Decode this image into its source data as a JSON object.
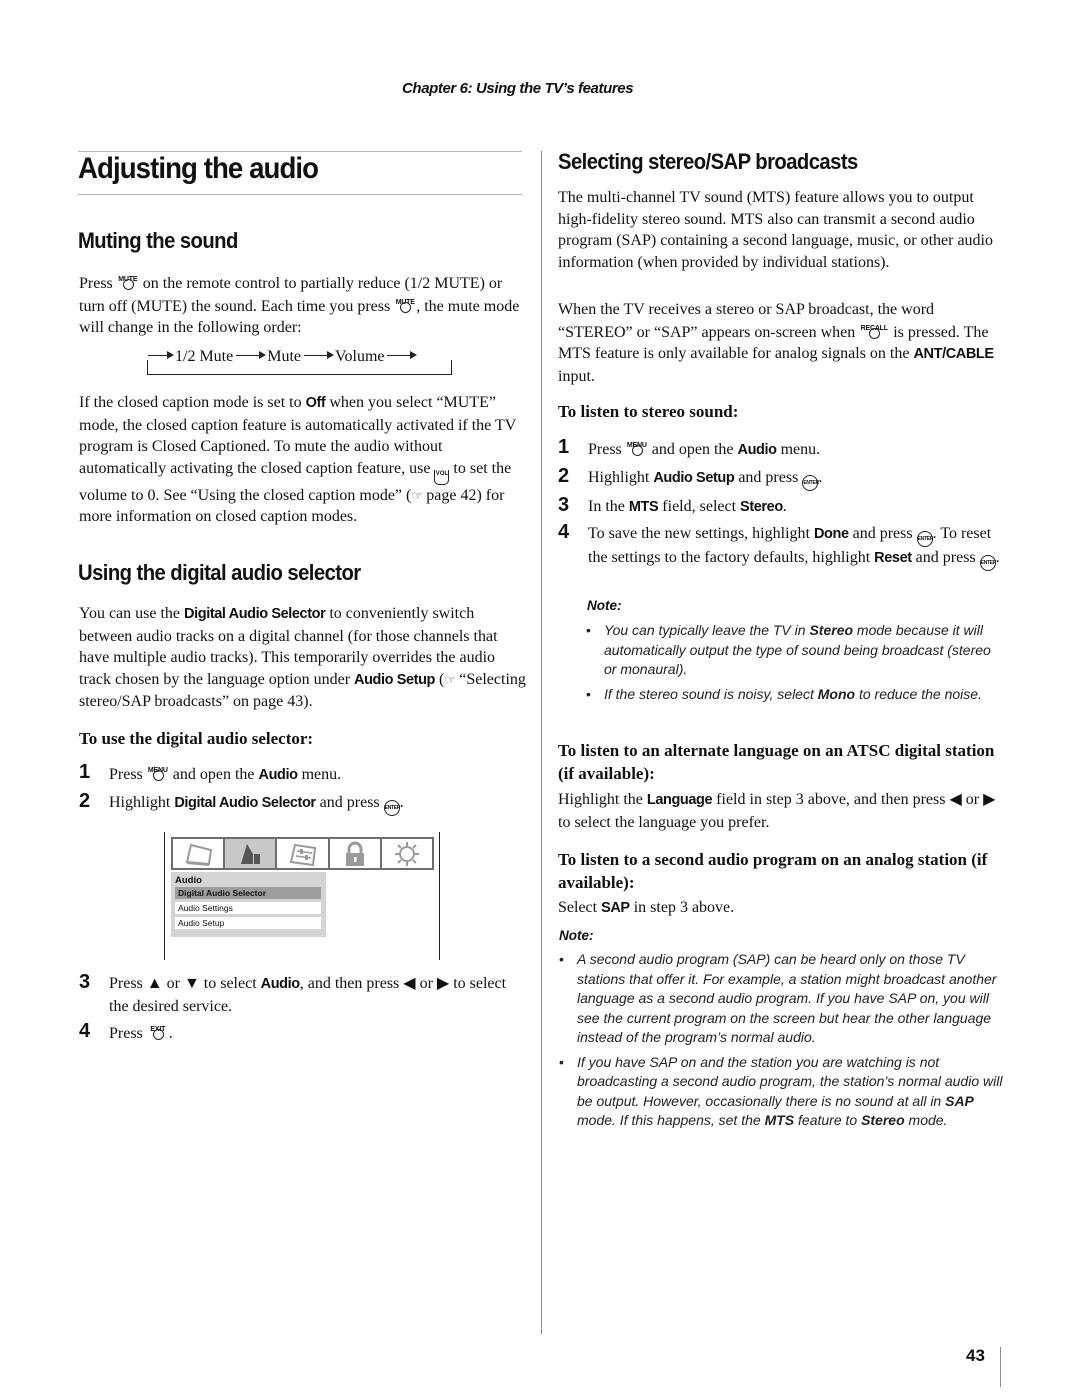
{
  "header": {
    "chapter": "Chapter 6: Using the TV’s features"
  },
  "page_number": "43",
  "left": {
    "title": "Adjusting the audio",
    "muting": {
      "heading": "Muting the sound",
      "p1": {
        "t1": "Press ",
        "key1": "MUTE",
        "t2": " on the remote control to partially reduce (1/2 MUTE) or turn off (MUTE) the sound. Each time you press ",
        "key2": "MUTE",
        "t3": ", the mute mode will change in the following order:"
      },
      "cycle": [
        "1/2 Mute",
        "Mute",
        "Volume"
      ],
      "p2": {
        "t1": "If the closed caption mode is set to ",
        "b1": "Off",
        "t2": " when you select “MUTE” mode, the closed caption feature is automatically activated if the TV program is Closed Captioned. To mute the audio without automatically activating the closed caption feature, use ",
        "key": "VOL",
        "t3": " to set the volume to 0. See “Using the closed caption mode” (",
        "ref": "page 42",
        "t4": ") for more information on closed caption modes."
      }
    },
    "digital": {
      "heading": "Using the digital audio selector",
      "p1": {
        "t1": "You can use the ",
        "b1": "Digital Audio Selector",
        "t2": " to conveniently switch between audio tracks on a digital channel (for those channels that have multiple audio tracks). This temporarily overrides the audio track chosen by the language option under ",
        "b2": "Audio Setup",
        "t3": " (",
        "ref": "“Selecting stereo/SAP broadcasts” on page 43",
        "t4": ")."
      },
      "subheading": "To use the digital audio selector:",
      "steps": [
        {
          "num": "1",
          "t1": "Press ",
          "key": "MENU",
          "t2": " and open the ",
          "b1": "Audio",
          "t3": " menu."
        },
        {
          "num": "2",
          "t1": "Highlight ",
          "b1": "Digital Audio Selector",
          "t2": " and press ",
          "key": "ENTER",
          "t3": "."
        },
        {
          "num": "3",
          "t1": "Press ▲ or ▼ to select ",
          "b1": "Audio",
          "t2": ", and then press ◀ or ▶ to select the desired service."
        },
        {
          "num": "4",
          "t1": "Press ",
          "key": "EXIT",
          "t2": "."
        }
      ],
      "menu": {
        "tabs": [
          "picture-icon",
          "audio-icon",
          "settings-icon",
          "lock-icon",
          "setup-icon"
        ],
        "active_tab": 1,
        "title": "Audio",
        "items": [
          "Digital Audio Selector",
          "Audio Settings",
          "Audio Setup"
        ],
        "selected": 0
      }
    }
  },
  "right": {
    "heading": "Selecting stereo/SAP broadcasts",
    "p1": "The multi-channel TV sound (MTS) feature allows you to output high-fidelity stereo sound. MTS also can transmit a second audio program (SAP) containing a second language, music, or other audio information (when provided by individual stations).",
    "p2": {
      "t1": "When the TV receives a stereo or SAP broadcast, the word “STEREO” or “SAP” appears on-screen when ",
      "key": "RECALL",
      "t2": " is pressed. The MTS feature is only available for analog signals on the ",
      "b1": "ANT/CABLE",
      "t3": " input."
    },
    "stereo": {
      "subheading": "To listen to stereo sound:",
      "steps": [
        {
          "num": "1",
          "t1": "Press ",
          "key": "MENU",
          "t2": " and open the ",
          "b1": "Audio",
          "t3": " menu."
        },
        {
          "num": "2",
          "t1": "Highlight ",
          "b1": "Audio Setup",
          "t2": " and press ",
          "key": "ENTER",
          "t3": "."
        },
        {
          "num": "3",
          "t1": "In the ",
          "b1": "MTS",
          "t2": " field, select ",
          "b2": "Stereo",
          "t3": "."
        },
        {
          "num": "4",
          "t1": "To save the new settings, highlight ",
          "b1": "Done",
          "t2": " and press ",
          "key": "ENTER",
          "t3": ". To reset the settings to the factory defaults, highlight ",
          "b2": "Reset",
          "t4": " and press ",
          "t5": "."
        }
      ]
    },
    "note1": {
      "label": "Note:",
      "items": [
        {
          "t1": "You can typically leave the TV in ",
          "b1": "Stereo",
          "t2": " mode because it will automatically output the type of sound being broadcast (stereo or monaural)."
        },
        {
          "t1": "If the stereo sound is noisy, select ",
          "b1": "Mono",
          "t2": " to reduce the noise."
        }
      ]
    },
    "atsc": {
      "subheading": "To listen to an alternate language on an ATSC digital station (if available):",
      "t1": "Highlight the ",
      "b1": "Language",
      "t2": " field in step 3 above, and then press ◀ or ▶ to select the language you prefer."
    },
    "analog": {
      "subheading": "To listen to a second audio program on an analog station (if available):",
      "t1": "Select ",
      "b1": "SAP",
      "t2": " in step 3 above."
    },
    "note2": {
      "label": "Note:",
      "items": [
        {
          "t1": "A second audio program (SAP) can be heard only on those TV stations that offer it. For example, a station might broadcast another language as a second audio program. If you have SAP on, you will see the current program on the screen but hear the other language instead of the program’s normal audio."
        },
        {
          "t1": "If you have SAP on and the station you are watching is not broadcasting a second audio program, the station’s normal audio will be output. However, occasionally there is no sound at all in ",
          "b1": "SAP",
          "t2": " mode. If this happens, set the ",
          "b2": "MTS",
          "t3": " feature to ",
          "b3": "Stereo",
          "t4": " mode."
        }
      ]
    }
  }
}
